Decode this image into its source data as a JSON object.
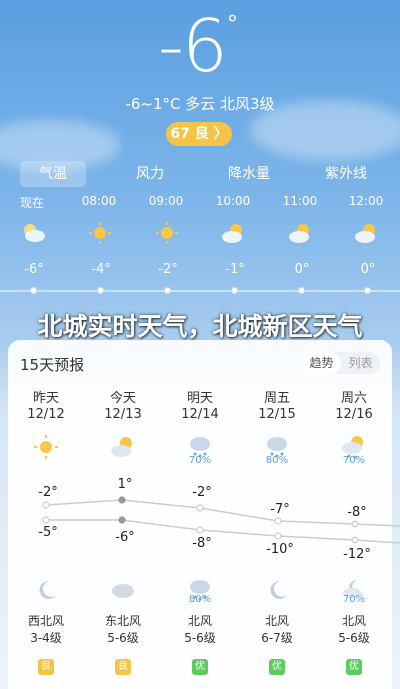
{
  "current": {
    "temp": "-6",
    "deg": "°",
    "summary": "-6~1°C  多云  北风3级",
    "aqi_label": "67 良 〉"
  },
  "tabs": [
    {
      "label": "气温",
      "active": true
    },
    {
      "label": "风力"
    },
    {
      "label": "降水量"
    },
    {
      "label": "紫外线"
    }
  ],
  "hourly": [
    {
      "time": "现在",
      "icon": "cloudy-night-icon",
      "temp": "-6°"
    },
    {
      "time": "08:00",
      "icon": "sun-icon",
      "temp": "-4°"
    },
    {
      "time": "09:00",
      "icon": "sun-icon",
      "temp": "-2°"
    },
    {
      "time": "10:00",
      "icon": "partly-cloudy-icon",
      "temp": "-1°"
    },
    {
      "time": "11:00",
      "icon": "partly-cloudy-icon",
      "temp": "0°"
    },
    {
      "time": "12:00",
      "icon": "partly-cloudy-icon",
      "temp": "0°"
    }
  ],
  "headline": "北城实时天气，北城新区天气",
  "forecast": {
    "title": "15天预报",
    "toggle": [
      "趋势",
      "列表"
    ],
    "days": [
      {
        "name": "昨天",
        "date": "12/12",
        "icon": "sun-icon",
        "pct": "",
        "hi": "-2°",
        "lo": "-5°",
        "nicon": "moon-icon",
        "npct": "",
        "wind": "西北风",
        "level": "3-4级",
        "aq": "良"
      },
      {
        "name": "今天",
        "date": "12/13",
        "icon": "partly-cloudy-icon",
        "pct": "",
        "hi": "1°",
        "lo": "-6°",
        "nicon": "cloudy-icon",
        "npct": "",
        "wind": "东北风",
        "level": "5-6级",
        "aq": "良"
      },
      {
        "name": "明天",
        "date": "12/14",
        "icon": "snow-icon",
        "pct": "70%",
        "hi": "-2°",
        "lo": "-8°",
        "nicon": "snow-icon",
        "npct": "80%",
        "wind": "北风",
        "level": "5-6级",
        "aq": "优"
      },
      {
        "name": "周五",
        "date": "12/15",
        "icon": "snow-icon",
        "pct": "80%",
        "hi": "-7°",
        "lo": "-10°",
        "nicon": "moon-icon",
        "npct": "",
        "wind": "北风",
        "level": "6-7级",
        "aq": "优"
      },
      {
        "name": "周六",
        "date": "12/16",
        "icon": "sun-snow-icon",
        "pct": "70%",
        "hi": "-8°",
        "lo": "-12°",
        "nicon": "moon-snow-icon",
        "npct": "70%",
        "wind": "北风",
        "level": "5-6级",
        "aq": "优"
      }
    ]
  },
  "colors": {
    "aq_good": "#f3c447",
    "aq_excellent": "#5ecb5e",
    "accent": "#5a9fe0"
  }
}
